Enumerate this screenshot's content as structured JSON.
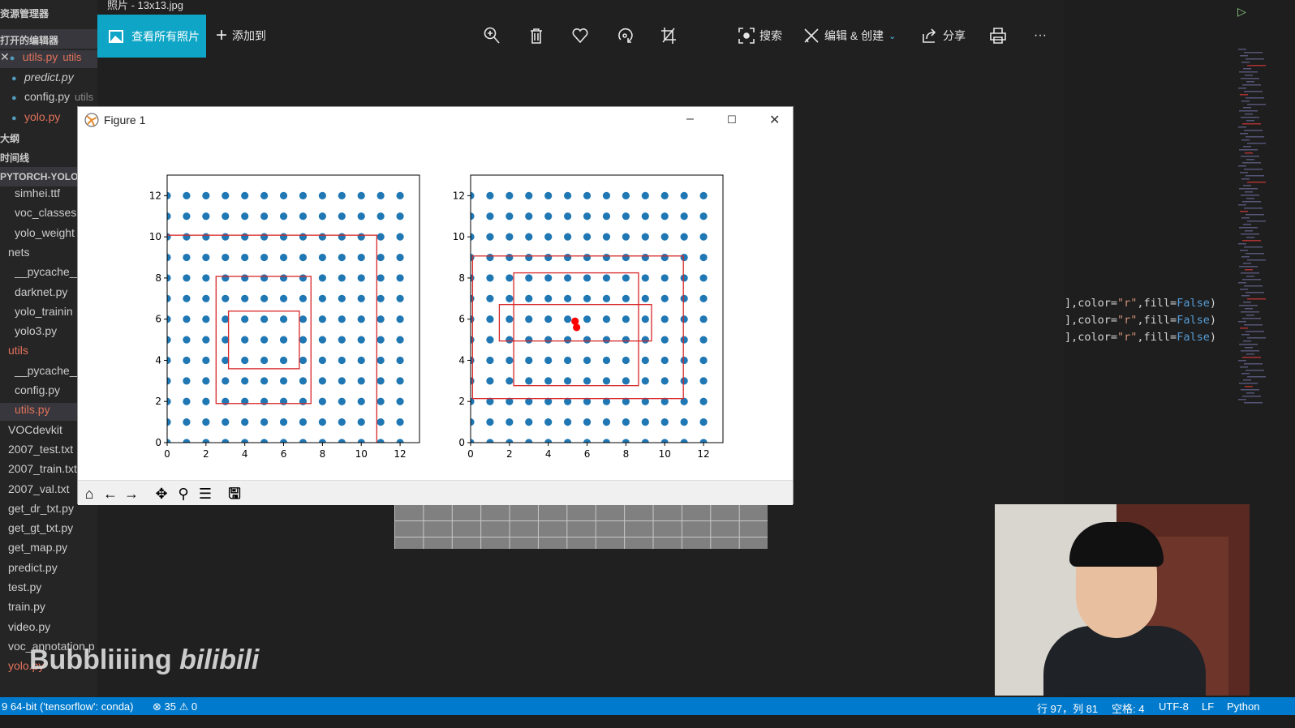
{
  "sidebar": {
    "explorer_title": "资源管理器",
    "open_editors_title": "打开的编辑器",
    "open_editors": [
      {
        "name": "utils.py",
        "hint": "utils",
        "modified": true
      },
      {
        "name": "predict.py",
        "hint": ""
      },
      {
        "name": "config.py",
        "hint": "utils"
      },
      {
        "name": "yolo.py",
        "hint": "",
        "modified": true
      }
    ],
    "outline_title": "大纲",
    "timeline_title": "时间线",
    "project_title": "PYTORCH-YOLOV",
    "files": [
      "simhei.ttf",
      "voc_classes.",
      "yolo_weight",
      "nets",
      "__pycache__",
      "darknet.py",
      "yolo_trainin",
      "yolo3.py",
      "utils",
      "__pycache__",
      "config.py",
      "utils.py",
      "VOCdevkit",
      "2007_test.txt",
      "2007_train.txt",
      "2007_val.txt",
      "get_dr_txt.py",
      "get_gt_txt.py",
      "get_map.py",
      "predict.py",
      "test.py",
      "train.py",
      "video.py",
      "voc_annotation.p",
      "yolo.py"
    ]
  },
  "photos": {
    "title": "照片 - 13x13.jpg",
    "view_all": "查看所有照片",
    "add_to": "添加到",
    "search": "搜索",
    "edit_create": "编辑 & 创建",
    "share": "分享",
    "more": "···"
  },
  "editor": {
    "lines": [
      {
        "pre": "],color=",
        "str": "\"r\"",
        "mid": ",fill=",
        "kw": "False",
        "post": ")"
      },
      {
        "pre": "],color=",
        "str": "\"r\"",
        "mid": ",fill=",
        "kw": "False",
        "post": ")"
      },
      {
        "pre": "],color=",
        "str": "\"r\"",
        "mid": ",fill=",
        "kw": "False",
        "post": ")"
      }
    ]
  },
  "figure": {
    "title": "Figure 1",
    "minimize": "–",
    "maximize": "☐",
    "close": "✕"
  },
  "chart_data": [
    {
      "type": "scatter",
      "xlim": [
        0,
        13
      ],
      "ylim": [
        0,
        13
      ],
      "xticks": [
        0,
        2,
        4,
        6,
        8,
        10,
        12
      ],
      "yticks": [
        0,
        2,
        4,
        6,
        8,
        10,
        12
      ],
      "grid_points": {
        "x": [
          0,
          1,
          2,
          3,
          4,
          5,
          6,
          7,
          8,
          9,
          10,
          11,
          12
        ],
        "y": [
          0,
          1,
          2,
          3,
          4,
          5,
          6,
          7,
          8,
          9,
          10,
          11,
          12
        ],
        "color": "#1f77b4"
      },
      "rectangles": [
        {
          "x0": -0.8,
          "y0": -0.1,
          "x1": 10.8,
          "y1": 10.08
        },
        {
          "x0": 2.52,
          "y0": 1.9,
          "x1": 7.41,
          "y1": 8.08
        },
        {
          "x0": 3.16,
          "y0": 3.59,
          "x1": 6.81,
          "y1": 6.39
        }
      ],
      "rect_color": "#d62728",
      "highlight_points": []
    },
    {
      "type": "scatter",
      "xlim": [
        0,
        13
      ],
      "ylim": [
        0,
        13
      ],
      "xticks": [
        0,
        2,
        4,
        6,
        8,
        10,
        12
      ],
      "yticks": [
        0,
        2,
        4,
        6,
        8,
        10,
        12
      ],
      "grid_points": {
        "x": [
          0,
          1,
          2,
          3,
          4,
          5,
          6,
          7,
          8,
          9,
          10,
          11,
          12
        ],
        "y": [
          0,
          1,
          2,
          3,
          4,
          5,
          6,
          7,
          8,
          9,
          10,
          11,
          12
        ],
        "color": "#1f77b4"
      },
      "rectangles": [
        {
          "x0": 0.1,
          "y0": 2.14,
          "x1": 10.96,
          "y1": 9.07
        },
        {
          "x0": 2.22,
          "y0": 2.77,
          "x1": 8.65,
          "y1": 8.25
        },
        {
          "x0": 1.48,
          "y0": 4.94,
          "x1": 9.32,
          "y1": 6.71
        }
      ],
      "rect_color": "#d62728",
      "highlight_points": [
        {
          "x": 5.38,
          "y": 5.9
        },
        {
          "x": 5.46,
          "y": 5.6
        }
      ],
      "highlight_color": "#ff0000"
    }
  ],
  "watermark": {
    "text": "Bubbliiiing",
    "logo": "bilibili"
  },
  "status": {
    "interpreter": "9 64-bit ('tensorflow': conda)",
    "errors": "35",
    "warnings": "0",
    "position": "行 97，列 81",
    "spaces": "空格: 4",
    "encoding": "UTF-8",
    "eol": "LF",
    "language": "Python"
  }
}
